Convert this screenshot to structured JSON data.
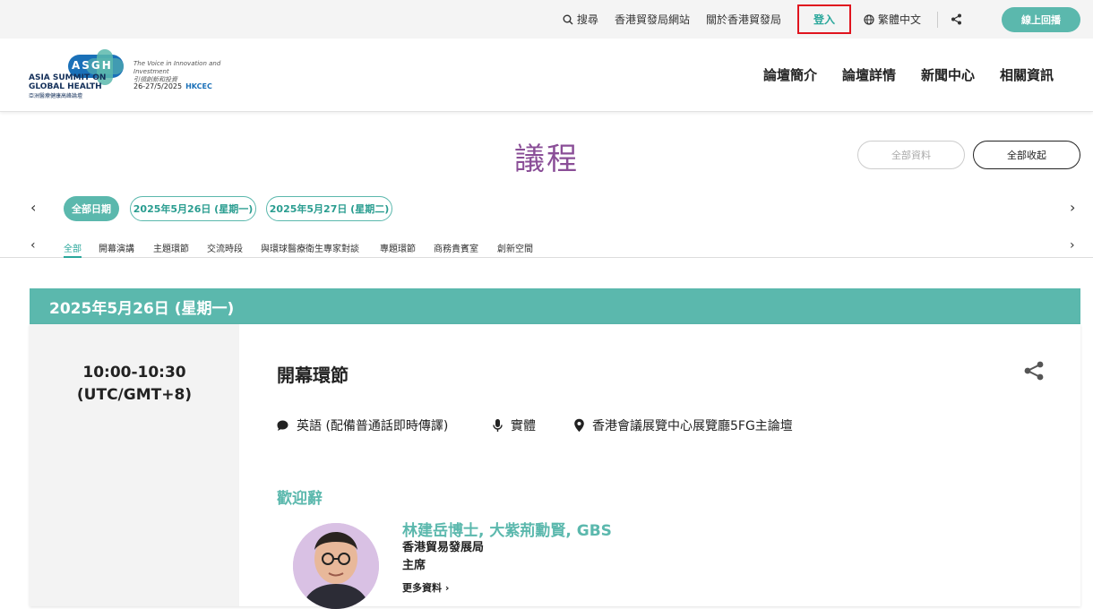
{
  "topbar": {
    "search": "搜尋",
    "hktdc_site": "香港貿發局網站",
    "about": "關於香港貿發局",
    "login": "登入",
    "language": "繁體中文",
    "cta": "線上回播"
  },
  "logo": {
    "acronym": "ASGH",
    "line1": "ASIA SUMMIT ON",
    "line2": "GLOBAL HEALTH",
    "line3": "亞洲醫療健康高峰論壇",
    "tagline1": "The Voice in Innovation and Investment",
    "tagline2": "引領創新和投資",
    "dates": "26-27/5/2025",
    "venue": "HKCEC"
  },
  "nav": [
    "論壇簡介",
    "論壇詳情",
    "新聞中心",
    "相關資訊"
  ],
  "page": {
    "title": "議程",
    "all_info": "全部資料",
    "collapse_all": "全部收起"
  },
  "dates": [
    "全部日期",
    "2025年5月26日 (星期一)",
    "2025年5月27日 (星期二)"
  ],
  "categories": [
    "全部",
    "開幕演講",
    "主題環節",
    "交流時段",
    "與環球醫療衛生專家對談",
    "專題環節",
    "商務貴賓室",
    "創新空間"
  ],
  "day": {
    "label": "2025年5月26日 (星期一)"
  },
  "session": {
    "time_line1": "10:00-10:30",
    "time_line2": "(UTC/GMT+8)",
    "title": "開幕環節",
    "language": "英語 (配備普通話即時傳譯)",
    "format": "實體",
    "location": "香港會議展覽中心展覽廳5FG主論壇",
    "section": "歡迎辭",
    "speaker": {
      "name": "林建岳博士, 大紫荊勳賢, GBS",
      "org": "香港貿易發展局",
      "role": "主席",
      "more": "更多資料 ›"
    }
  },
  "colors": {
    "accent": "#5bb8ad",
    "title_purple": "#8a4e97",
    "login_border": "#e0141e"
  }
}
